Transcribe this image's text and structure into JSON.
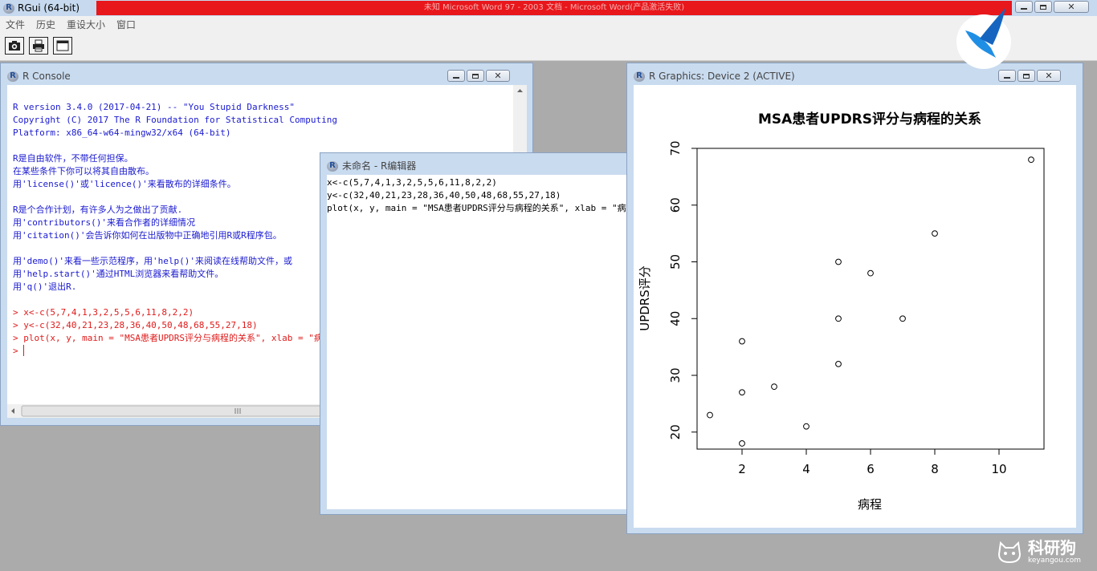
{
  "app": {
    "title": "RGui (64-bit)",
    "banner_text": "未知 Microsoft Word 97 - 2003 文档 - Microsoft Word(产品激活失败)"
  },
  "menu": [
    "文件",
    "历史",
    "重设大小",
    "窗口"
  ],
  "toolbar": {
    "icons": [
      "camera-icon",
      "printer-icon",
      "window-icon"
    ]
  },
  "console": {
    "title": "R Console",
    "lines": [
      {
        "text": "",
        "kind": "gap"
      },
      {
        "text": "R version 3.4.0 (2017-04-21) -- \"You Stupid Darkness\"",
        "kind": "out"
      },
      {
        "text": "Copyright (C) 2017 The R Foundation for Statistical Computing",
        "kind": "out"
      },
      {
        "text": "Platform: x86_64-w64-mingw32/x64 (64-bit)",
        "kind": "out"
      },
      {
        "text": "",
        "kind": "gap"
      },
      {
        "text": "R是自由软件，不带任何担保。",
        "kind": "out"
      },
      {
        "text": "在某些条件下你可以将其自由散布。",
        "kind": "out"
      },
      {
        "text": "用'license()'或'licence()'来看散布的详细条件。",
        "kind": "out"
      },
      {
        "text": "",
        "kind": "gap"
      },
      {
        "text": "R是个合作计划，有许多人为之做出了贡献.",
        "kind": "out"
      },
      {
        "text": "用'contributors()'来看合作者的详细情况",
        "kind": "out"
      },
      {
        "text": "用'citation()'会告诉你如何在出版物中正确地引用R或R程序包。",
        "kind": "out"
      },
      {
        "text": "",
        "kind": "gap"
      },
      {
        "text": "用'demo()'来看一些示范程序，用'help()'来阅读在线帮助文件，或",
        "kind": "out"
      },
      {
        "text": "用'help.start()'通过HTML浏览器来看帮助文件。",
        "kind": "out"
      },
      {
        "text": "用'q()'退出R.",
        "kind": "out"
      },
      {
        "text": "",
        "kind": "gap"
      },
      {
        "text": "> x<-c(5,7,4,1,3,2,5,5,6,11,8,2,2)",
        "kind": "cmd"
      },
      {
        "text": "> y<-c(32,40,21,23,28,36,40,50,48,68,55,27,18)",
        "kind": "cmd"
      },
      {
        "text": "> plot(x, y, main = \"MSA患者UPDRS评分与病程的关系\", xlab = \"病程\", ylab = \"UPDRS评分\")",
        "kind": "cmd"
      },
      {
        "text": "> ",
        "kind": "cmd",
        "caret": true
      }
    ]
  },
  "editor": {
    "title": "未命名 - R编辑器",
    "lines": [
      "x<-c(5,7,4,1,3,2,5,5,6,11,8,2,2)",
      "y<-c(32,40,21,23,28,36,40,50,48,68,55,27,18)",
      "plot(x, y, main = \"MSA患者UPDRS评分与病程的关系\", xlab = \"病程\", ylab = \"UPDRS评分\")"
    ]
  },
  "graphics": {
    "title": "R Graphics: Device 2 (ACTIVE)"
  },
  "watermark": {
    "brand": "科研狗",
    "site": "keyangou.com"
  },
  "chart_data": {
    "type": "scatter",
    "title": "MSA患者UPDRS评分与病程的关系",
    "xlabel": "病程",
    "ylabel": "UPDRS评分",
    "x": [
      5,
      7,
      4,
      1,
      3,
      2,
      5,
      5,
      6,
      11,
      8,
      2,
      2
    ],
    "y": [
      32,
      40,
      21,
      23,
      28,
      36,
      40,
      50,
      48,
      68,
      55,
      27,
      18
    ],
    "xlim": [
      0.6,
      11.4
    ],
    "ylim": [
      17,
      70
    ],
    "xticks": [
      2,
      4,
      6,
      8,
      10
    ],
    "yticks": [
      20,
      30,
      40,
      50,
      60,
      70
    ],
    "grid": false,
    "marker": "open-circle",
    "colors": {
      "axis": "#000000",
      "points": "#000000"
    }
  }
}
